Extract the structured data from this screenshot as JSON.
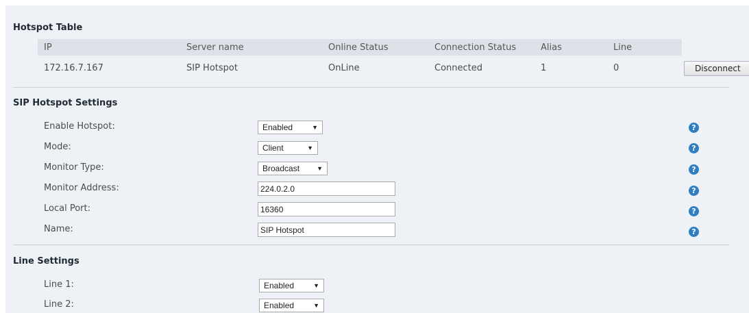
{
  "hotspot_table": {
    "title": "Hotspot Table",
    "columns": [
      "IP",
      "Server name",
      "Online Status",
      "Connection Status",
      "Alias",
      "Line"
    ],
    "rows": [
      {
        "ip": "172.16.7.167",
        "server_name": "SIP Hotspot",
        "online_status": "OnLine",
        "connection_status": "Connected",
        "alias": "1",
        "line": "0"
      }
    ],
    "disconnect_label": "Disconnect"
  },
  "sip_hotspot_settings": {
    "title": "SIP Hotspot Settings",
    "enable_hotspot": {
      "label": "Enable Hotspot:",
      "value": "Enabled"
    },
    "mode": {
      "label": "Mode:",
      "value": "Client"
    },
    "monitor_type": {
      "label": "Monitor Type:",
      "value": "Broadcast"
    },
    "monitor_address": {
      "label": "Monitor Address:",
      "value": "224.0.2.0"
    },
    "local_port": {
      "label": "Local Port:",
      "value": "16360"
    },
    "name": {
      "label": "Name:",
      "value": "SIP Hotspot"
    },
    "help_icon": "question-mark"
  },
  "line_settings": {
    "title": "Line Settings",
    "line1": {
      "label": "Line 1:",
      "value": "Enabled"
    },
    "line2": {
      "label": "Line 2:",
      "value": "Enabled"
    }
  },
  "colors": {
    "panel_bg": "#eef2f7",
    "header_bg": "#dde2e8",
    "help_icon": "#2f7fc1"
  }
}
